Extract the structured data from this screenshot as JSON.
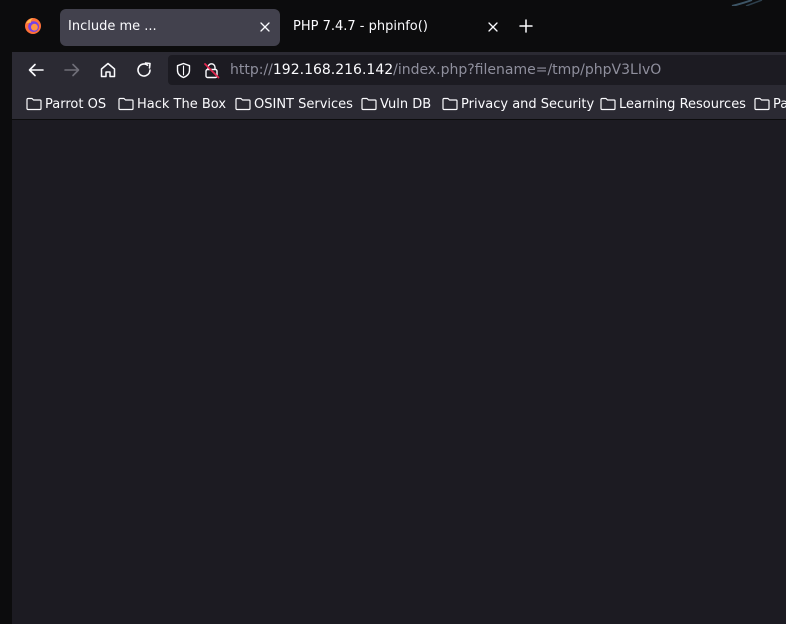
{
  "browser": {
    "tabs": [
      {
        "title": "Include me ...",
        "active": true
      },
      {
        "title": "PHP 7.4.7 - phpinfo()",
        "active": false
      }
    ]
  },
  "address_bar": {
    "scheme": "http://",
    "host": "192.168.216.142",
    "path": "/index.php?filename=/tmp/phpV3LIvO"
  },
  "bookmarks": [
    {
      "label": "Parrot OS"
    },
    {
      "label": "Hack The Box"
    },
    {
      "label": "OSINT Services"
    },
    {
      "label": "Vuln DB"
    },
    {
      "label": "Privacy and Security"
    },
    {
      "label": "Learning Resources"
    },
    {
      "label": "Pa"
    }
  ],
  "icons": {
    "browser_logo": "firefox-logo-icon",
    "tab_close": "close-icon",
    "new_tab": "plus-icon",
    "back": "arrow-left-icon",
    "forward": "arrow-right-icon",
    "home": "home-icon",
    "reload": "reload-icon",
    "tracking_protection": "shield-icon",
    "insecure_connection": "broken-lock-icon",
    "bookmark_folder": "folder-icon"
  },
  "colors": {
    "tabstrip": "#0c0c0d",
    "toolbar": "#2b2a33",
    "active_tab": "#42414d",
    "page_background": "#1c1b22",
    "text": "#fbfbfe",
    "dim_text": "#8f8f9d",
    "insecure_accent": "#e22850"
  }
}
